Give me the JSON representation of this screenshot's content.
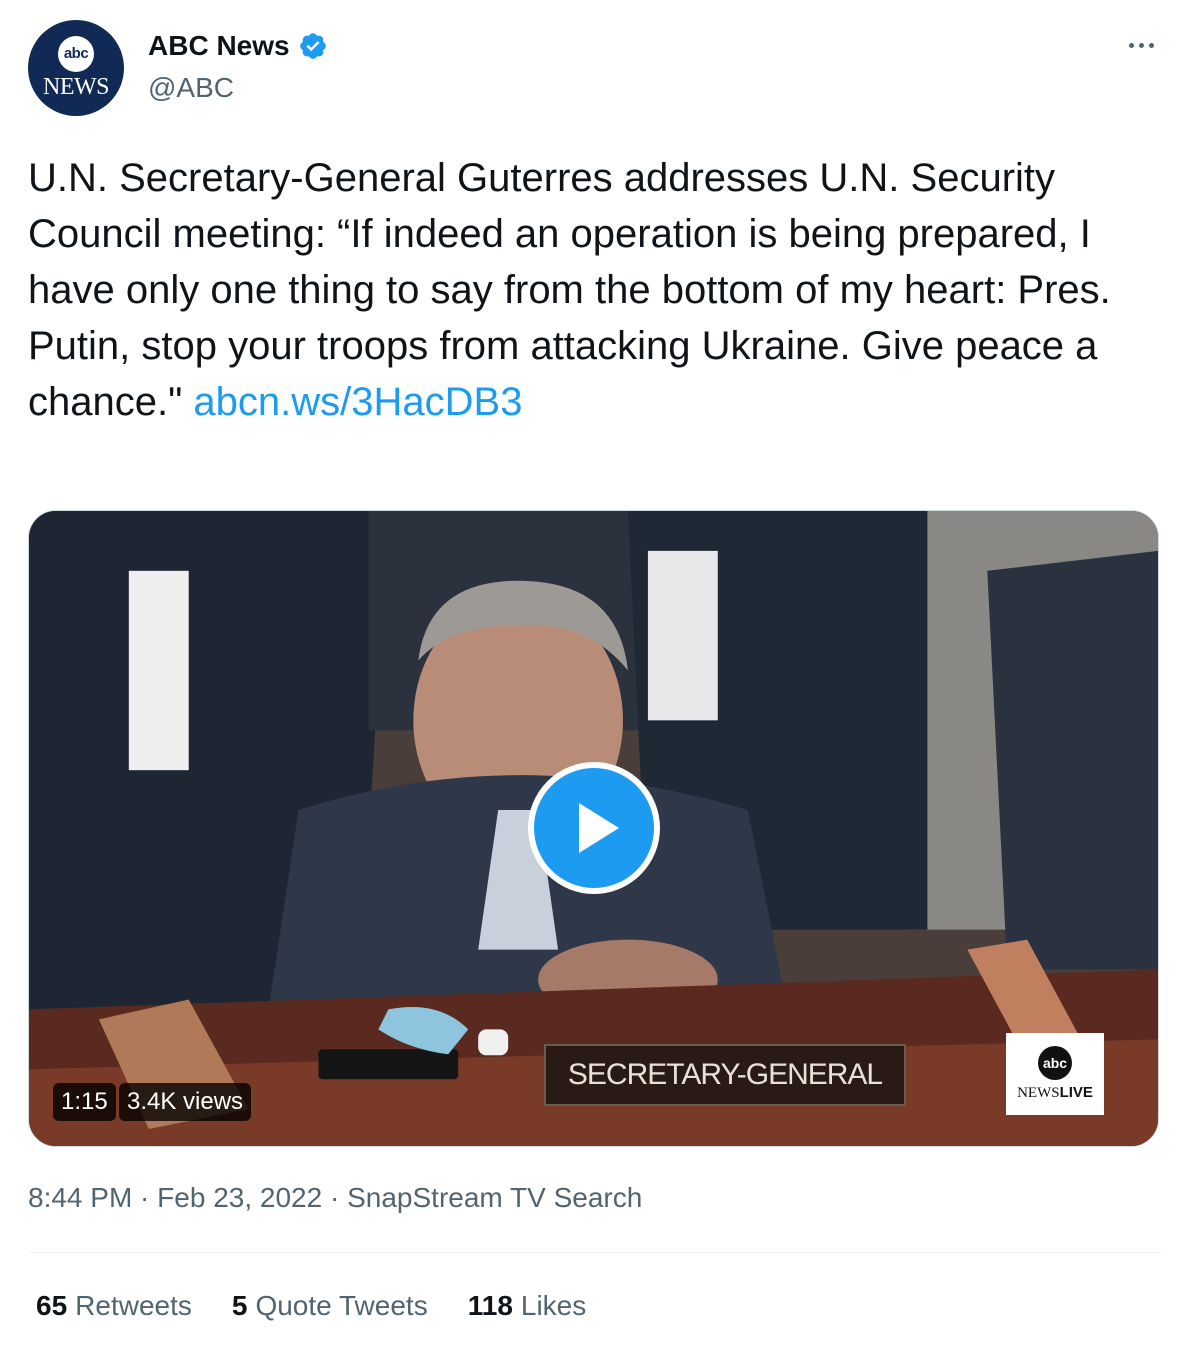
{
  "author": {
    "avatar_badge": "abc",
    "avatar_sub": "NEWS",
    "display_name": "ABC News",
    "handle": "@ABC",
    "verified": true
  },
  "tweet": {
    "text": "U.N. Secretary-General Guterres addresses U.N. Security Council meeting: “If indeed an operation is being prepared, I have only one thing to say from the bottom of my heart: Pres. Putin, stop your troops from attacking Ukraine. Give peace a chance.\" ",
    "link": "abcn.ws/3HacDB3"
  },
  "media": {
    "duration": "1:15",
    "views": "3.4K views",
    "nameplate": "SECRETARY-GENERAL",
    "logo_badge": "abc",
    "logo_news": "NEWS",
    "logo_live": "LIVE"
  },
  "meta": {
    "time": "8:44 PM",
    "date": "Feb 23, 2022",
    "source": "SnapStream TV Search"
  },
  "stats": {
    "retweets_count": "65",
    "retweets_label": "Retweets",
    "quotes_count": "5",
    "quotes_label": "Quote Tweets",
    "likes_count": "118",
    "likes_label": "Likes"
  },
  "colors": {
    "link": "#1d9bf0",
    "secondary_text": "#536471",
    "primary_text": "#0f1419"
  }
}
